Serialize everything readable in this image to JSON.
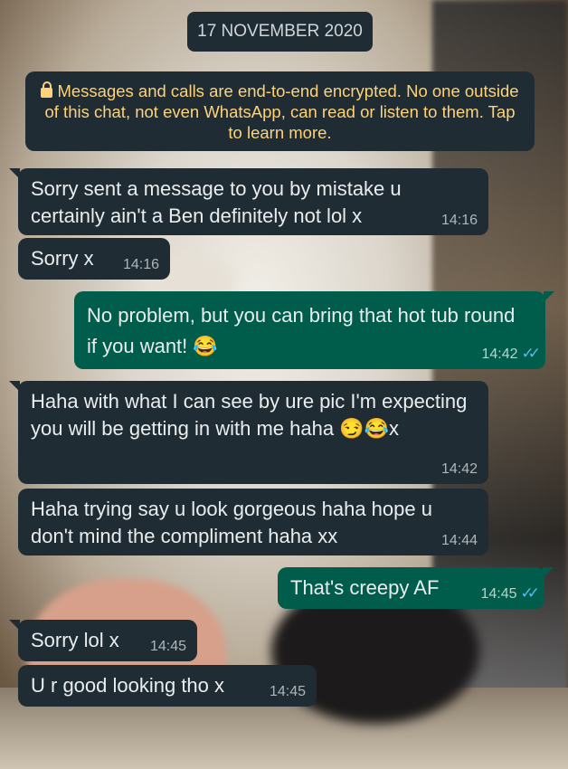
{
  "date_chip": "17 NOVEMBER 2020",
  "encryption_notice": "Messages and calls are end-to-end encrypted. No one outside of this chat, not even WhatsApp, can read or listen to them. Tap to learn more.",
  "messages": [
    {
      "direction": "in",
      "text": "Sorry sent a message to you by mistake u certainly ain't a Ben definitely not lol x",
      "time": "14:16"
    },
    {
      "direction": "in",
      "text": "Sorry x",
      "time": "14:16"
    },
    {
      "direction": "out",
      "text": "No problem, but you can bring that hot tub round if you want! 😂",
      "time": "14:42",
      "status": "read"
    },
    {
      "direction": "in",
      "text": "Haha with what I can see by ure pic I'm expecting you will be getting in with me haha 😏😂x",
      "time": "14:42"
    },
    {
      "direction": "in",
      "text": "Haha trying say u look gorgeous haha hope u don't mind the compliment haha xx",
      "time": "14:44"
    },
    {
      "direction": "out",
      "text": "That's creepy AF",
      "time": "14:45",
      "status": "read"
    },
    {
      "direction": "in",
      "text": "Sorry lol x",
      "time": "14:45"
    },
    {
      "direction": "in",
      "text": "U r good looking tho x",
      "time": "14:45"
    }
  ],
  "icons": {
    "lock": "lock-icon",
    "read_receipt": "double-check-icon"
  },
  "colors": {
    "incoming": "#1f2c33",
    "outgoing": "#005c4b",
    "notice_text": "#ffd279",
    "read_ticks": "#53bdeb"
  }
}
